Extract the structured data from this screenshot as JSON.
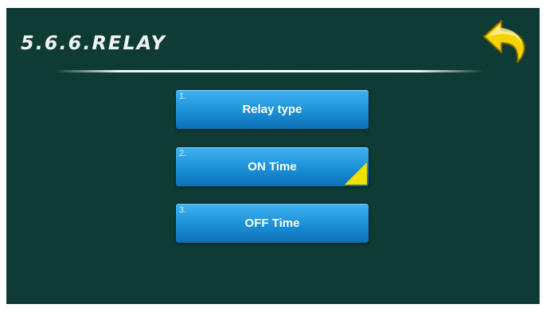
{
  "header": {
    "title": "5.6.6.RELAY"
  },
  "back_button": {
    "icon": "back-arrow-icon",
    "color": "#f3d400"
  },
  "menu": {
    "items": [
      {
        "number": "1.",
        "label": "Relay type"
      },
      {
        "number": "2.",
        "label": "ON Time",
        "has_corner_marker": true
      },
      {
        "number": "3.",
        "label": "OFF Time"
      }
    ]
  },
  "colors": {
    "background": "#0e3b33",
    "button": "#1d93da",
    "accent": "#f3e000"
  }
}
